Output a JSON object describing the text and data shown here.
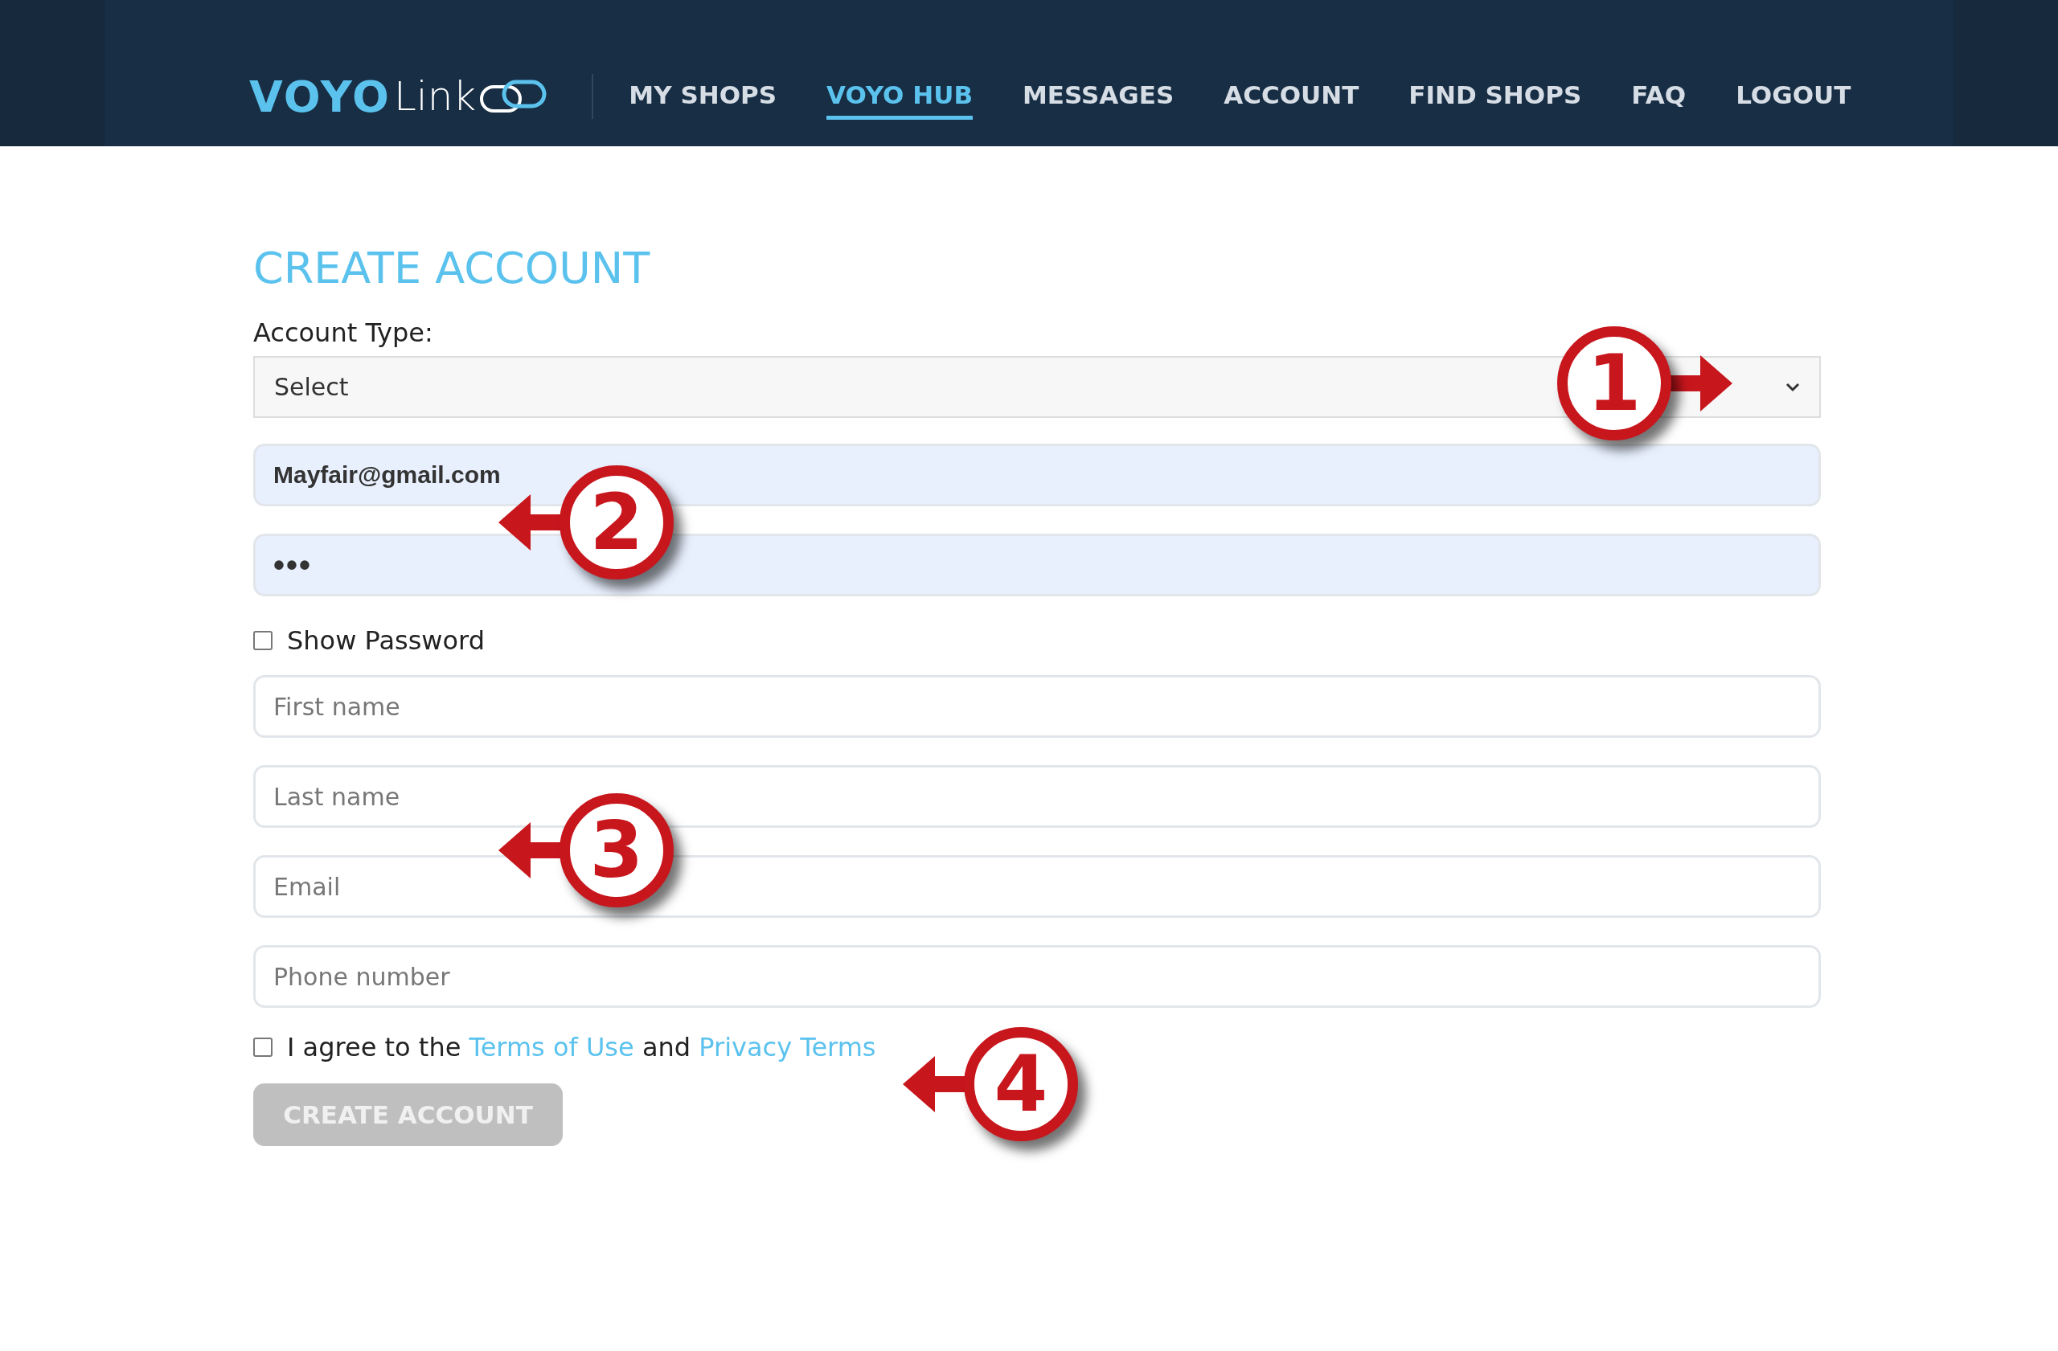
{
  "header": {
    "logo": {
      "brand": "VOYO",
      "suffix": "Link"
    },
    "nav": [
      {
        "label": "MY SHOPS",
        "selected": false
      },
      {
        "label": "VOYO HUB",
        "selected": true
      },
      {
        "label": "MESSAGES",
        "selected": false
      },
      {
        "label": "ACCOUNT",
        "selected": false
      },
      {
        "label": "FIND SHOPS",
        "selected": false
      },
      {
        "label": "FAQ",
        "selected": false
      },
      {
        "label": "LOGOUT",
        "selected": false
      }
    ]
  },
  "form": {
    "title": "CREATE ACCOUNT",
    "account_type": {
      "label": "Account Type:",
      "value": "Select"
    },
    "login_fields": [
      {
        "value": "Mayfair@gmail.com",
        "kind": "text"
      },
      {
        "value": "•••",
        "kind": "password"
      }
    ],
    "show_password": {
      "label": "Show Password",
      "checked": false
    },
    "fields": [
      {
        "placeholder": "First name"
      },
      {
        "placeholder": "Last name"
      },
      {
        "placeholder": "Email"
      },
      {
        "placeholder": "Phone number"
      }
    ],
    "agree": {
      "checked": false,
      "text": "I agree to the",
      "link1": "Terms of Use",
      "and": "and",
      "link2": "Privacy Terms"
    },
    "submit": {
      "label": "CREATE ACCOUNT",
      "disabled": true
    }
  },
  "callouts": [
    {
      "number": "1",
      "kind": "right"
    },
    {
      "number": "2",
      "kind": "left"
    },
    {
      "number": "3",
      "kind": "left"
    },
    {
      "number": "4",
      "kind": "left"
    }
  ]
}
